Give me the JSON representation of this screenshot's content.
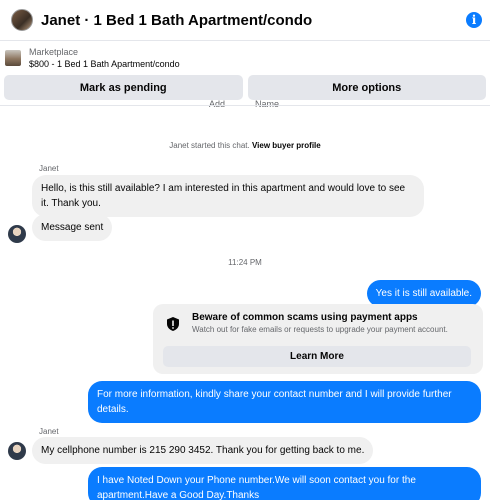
{
  "header": {
    "title": "Janet · 1 Bed 1 Bath Apartment/condo",
    "info_icon": "i"
  },
  "listing": {
    "label": "Marketplace",
    "title": "$800 - 1 Bed 1 Bath Apartment/condo"
  },
  "actions": {
    "mark_pending": "Mark as pending",
    "more_options": "More options"
  },
  "cut_labels": [
    "Add",
    "Name"
  ],
  "system_note": {
    "text": "Janet started this chat. ",
    "link": "View buyer profile"
  },
  "messages": [
    {
      "sender": "Janet",
      "text": "Hello, is this still available? I am interested in this apartment and would love to see it. Thank you."
    },
    {
      "text": "Message sent"
    },
    {
      "time": "11:24 PM"
    },
    {
      "text": "Yes it is still available."
    },
    {
      "text": "For more information, kindly share your contact number and I will provide further details."
    },
    {
      "sender": "Janet",
      "text": "My cellphone number is 215 290 3452.  Thank you for getting back to me."
    },
    {
      "text": "I have Noted Down your Phone number.We will soon contact you for the apartment.Have a Good Day.Thanks"
    }
  ],
  "safety": {
    "title": "Beware of common scams using payment apps",
    "description": "Watch out for fake emails or requests to upgrade your payment account.",
    "button": "Learn More"
  },
  "colors": {
    "accent": "#0a7cff",
    "bubble_in": "#f0f0f0",
    "button_bg": "#e4e6eb"
  }
}
